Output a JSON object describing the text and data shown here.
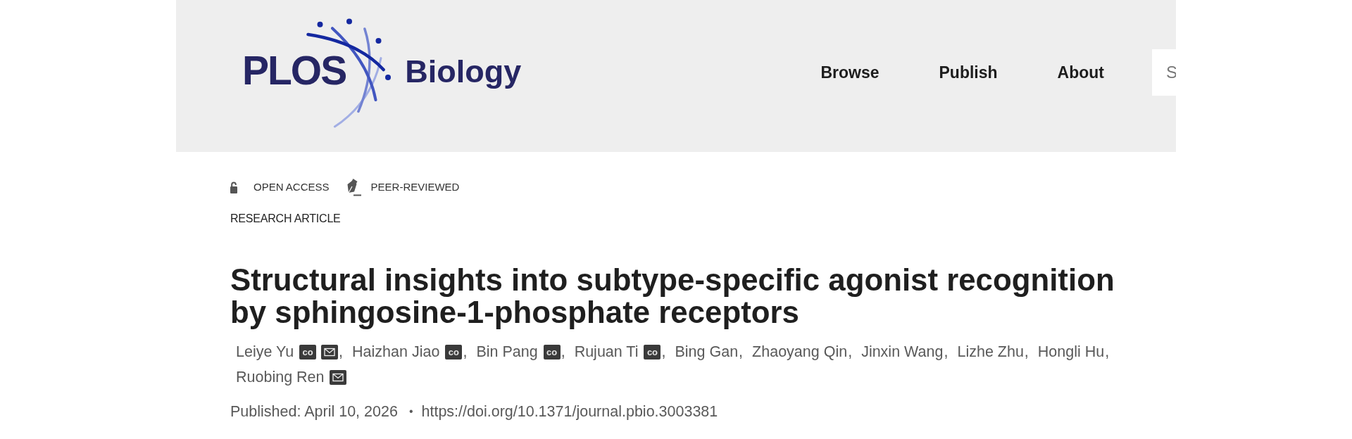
{
  "header": {
    "logo": {
      "name": "PLOS",
      "journal": "Biology"
    },
    "nav": [
      "Browse",
      "Publish",
      "About"
    ],
    "search": {
      "placeholder": "S"
    }
  },
  "badges": [
    {
      "kind": "open-access",
      "label": "OPEN ACCESS"
    },
    {
      "kind": "peer-reviewed",
      "label": "PEER-REVIEWED"
    }
  ],
  "article": {
    "type": "RESEARCH ARTICLE",
    "title": "Structural insights into subtype-specific agonist recognition by sphingosine-1-phosphate receptors",
    "authors": [
      {
        "name": "Leiye Yu",
        "marks": [
          {
            "kind": "equal",
            "text": "co"
          },
          {
            "kind": "corresponding"
          }
        ],
        "separator": ","
      },
      {
        "name": "Haizhan Jiao",
        "marks": [
          {
            "kind": "equal",
            "text": "co"
          }
        ],
        "separator": ","
      },
      {
        "name": "Bin Pang",
        "marks": [
          {
            "kind": "equal",
            "text": "co"
          }
        ],
        "separator": ","
      },
      {
        "name": "Rujuan Ti",
        "marks": [
          {
            "kind": "equal",
            "text": "co"
          }
        ],
        "separator": ","
      },
      {
        "name": "Bing Gan",
        "separator": ","
      },
      {
        "name": "Zhaoyang Qin",
        "separator": ","
      },
      {
        "name": "Jinxin Wang",
        "separator": ","
      },
      {
        "name": "Lizhe Zhu",
        "separator": ","
      },
      {
        "name": "Hongli Hu",
        "separator": ","
      },
      {
        "name": "Ruobing Ren",
        "marks": [
          {
            "kind": "corresponding"
          }
        ]
      }
    ],
    "published": "Published: April 10, 2026",
    "separator": "•",
    "doi": "https://doi.org/10.1371/journal.pbio.3003381"
  }
}
